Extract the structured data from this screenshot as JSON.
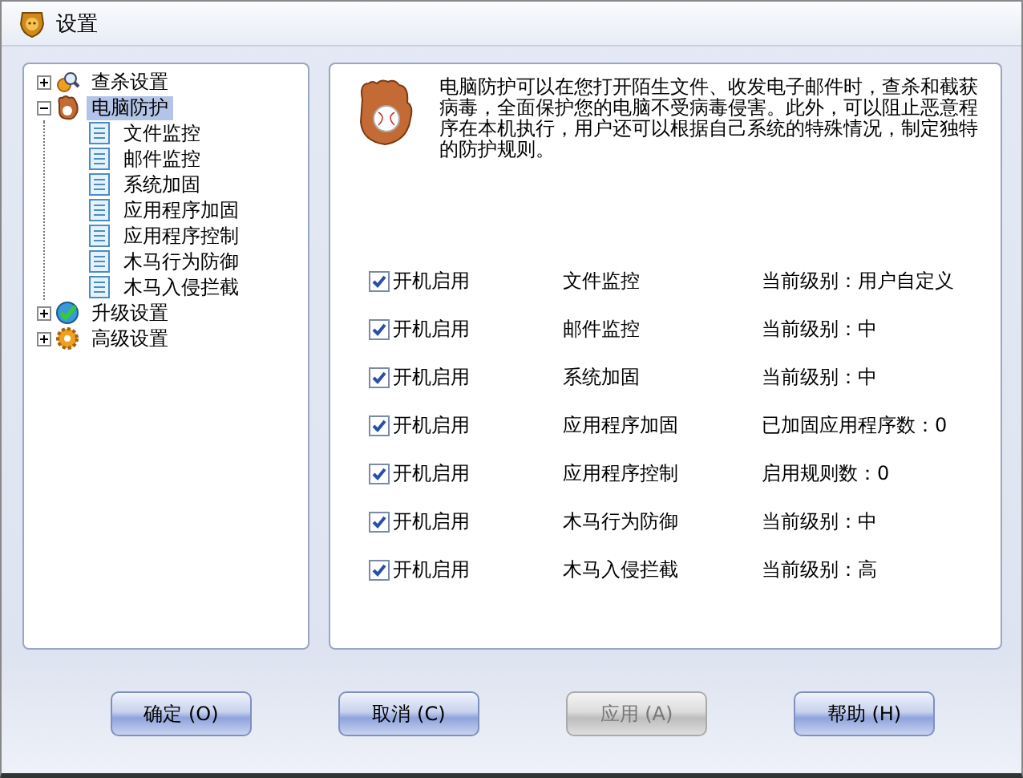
{
  "window": {
    "title": "设置"
  },
  "tree": [
    {
      "label": "查杀设置",
      "expanded": false,
      "selected": false
    },
    {
      "label": "电脑防护",
      "expanded": true,
      "selected": true,
      "children": [
        {
          "label": "文件监控",
          "selected": false
        },
        {
          "label": "邮件监控",
          "selected": false
        },
        {
          "label": "系统加固",
          "selected": false
        },
        {
          "label": "应用程序加固",
          "selected": false
        },
        {
          "label": "应用程序控制",
          "selected": false
        },
        {
          "label": "木马行为防御",
          "selected": false
        },
        {
          "label": "木马入侵拦截",
          "selected": false
        }
      ]
    },
    {
      "label": "升级设置",
      "expanded": false,
      "selected": false
    },
    {
      "label": "高级设置",
      "expanded": false,
      "selected": false
    }
  ],
  "description": "电脑防护可以在您打开陌生文件、收发电子邮件时，查杀和截获病毒，全面保护您的电脑不受病毒侵害。此外，可以阻止恶意程序在本机执行，用户还可以根据自己系统的特殊情况，制定独特的防护规则。",
  "rows": [
    {
      "option": "开机启用",
      "checked": true,
      "name": "文件监控",
      "status": "当前级别：用户自定义"
    },
    {
      "option": "开机启用",
      "checked": true,
      "name": "邮件监控",
      "status": "当前级别：中"
    },
    {
      "option": "开机启用",
      "checked": true,
      "name": "系统加固",
      "status": "当前级别：中"
    },
    {
      "option": "开机启用",
      "checked": true,
      "name": "应用程序加固",
      "status": "已加固应用程序数：0"
    },
    {
      "option": "开机启用",
      "checked": true,
      "name": "应用程序控制",
      "status": "启用规则数：0"
    },
    {
      "option": "开机启用",
      "checked": true,
      "name": "木马行为防御",
      "status": "当前级别：中"
    },
    {
      "option": "开机启用",
      "checked": true,
      "name": "木马入侵拦截",
      "status": "当前级别：高"
    }
  ],
  "buttons": [
    {
      "label": "确定 (O)",
      "disabled": false
    },
    {
      "label": "取消 (C)",
      "disabled": false
    },
    {
      "label": "应用 (A)",
      "disabled": true
    },
    {
      "label": "帮助 (H)",
      "disabled": false
    }
  ]
}
